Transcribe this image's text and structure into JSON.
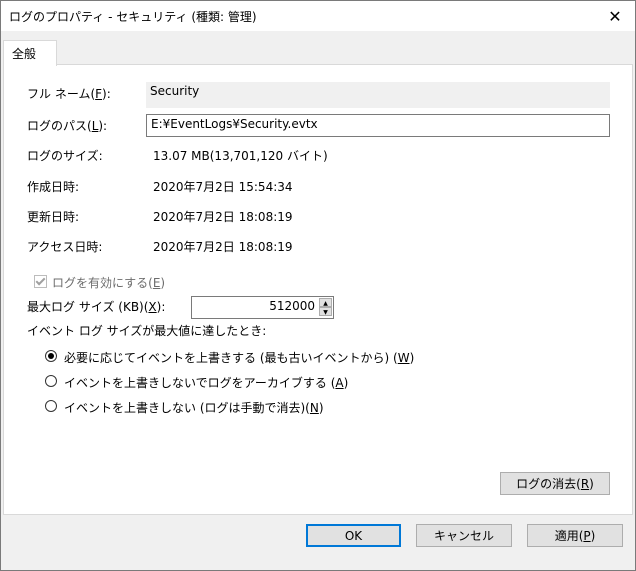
{
  "window": {
    "title": "ログのプロパティ - セキュリティ (種類: 管理)",
    "close_glyph": "✕"
  },
  "tabs": [
    {
      "label": "全般"
    }
  ],
  "general": {
    "full_name_label_pre": "フル ネーム(",
    "full_name_label_key": "F",
    "full_name_label_post": "):",
    "full_name_value": "Security",
    "log_path_label_pre": "ログのパス(",
    "log_path_label_key": "L",
    "log_path_label_post": "):",
    "log_path_value": "E:¥EventLogs¥Security.evtx",
    "log_size_label": "ログのサイズ:",
    "log_size_value": "13.07 MB(13,701,120 バイト)",
    "created_label": "作成日時:",
    "created_value": "2020年7月2日 15:54:34",
    "modified_label": "更新日時:",
    "modified_value": "2020年7月2日 18:08:19",
    "accessed_label": "アクセス日時:",
    "accessed_value": "2020年7月2日 18:08:19"
  },
  "enable_logging": {
    "label_pre": "ログを有効にする(",
    "label_key": "E",
    "label_post": ")",
    "checked": true,
    "disabled": true
  },
  "max_size": {
    "label_pre": "最大ログ サイズ (KB)(",
    "label_key": "X",
    "label_post": "):",
    "value": "512000"
  },
  "policy": {
    "heading": "イベント ログ サイズが最大値に達したとき:",
    "options": [
      {
        "pre": "必要に応じてイベントを上書きする (最も古いイベントから)  (",
        "key": "W",
        "post": ")",
        "checked": true
      },
      {
        "pre": "イベントを上書きしないでログをアーカイブする (",
        "key": "A",
        "post": ")",
        "checked": false
      },
      {
        "pre": "イベントを上書きしない (ログは手動で消去)(",
        "key": "N",
        "post": ")",
        "checked": false
      }
    ]
  },
  "buttons": {
    "clear_pre": "ログの消去(",
    "clear_key": "R",
    "clear_post": ")",
    "ok": "OK",
    "cancel": "キャンセル",
    "apply_pre": "適用(",
    "apply_key": "P",
    "apply_post": ")"
  }
}
